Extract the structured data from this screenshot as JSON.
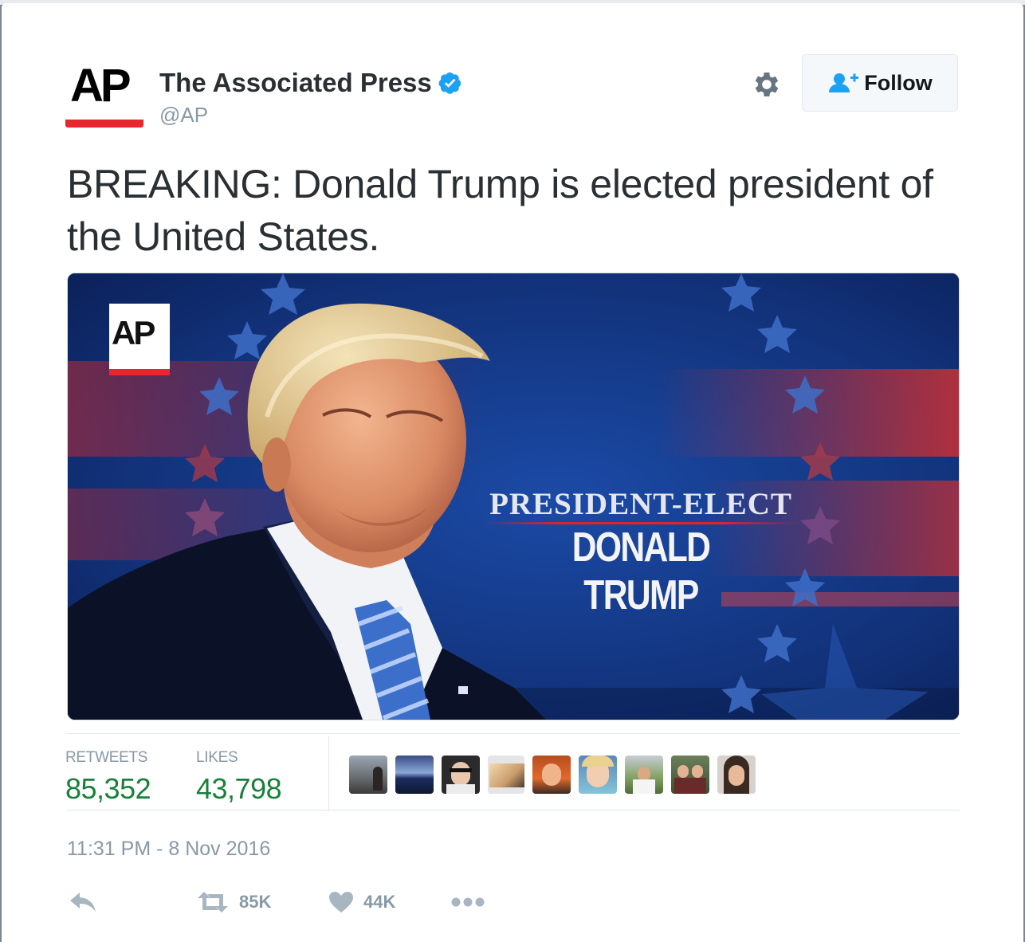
{
  "account": {
    "name": "The Associated Press",
    "handle": "@AP",
    "logo_text": "AP",
    "verified": true
  },
  "follow_button": {
    "label": "Follow"
  },
  "tweet": {
    "text": "BREAKING:  Donald Trump is elected president of the United States."
  },
  "media": {
    "logo_text": "AP",
    "line1": "PRESIDENT-ELECT",
    "line2": "DONALD TRUMP"
  },
  "stats": {
    "retweets_label": "RETWEETS",
    "retweets_value": "85,352",
    "likes_label": "LIKES",
    "likes_value": "43,798"
  },
  "liker_count_shown": 9,
  "timestamp": "11:31 PM - 8 Nov 2016",
  "actions": {
    "retweet_count": "85K",
    "like_count": "44K"
  },
  "colors": {
    "accent_blue": "#1da1f2",
    "stat_green": "#19803a",
    "ap_red": "#e8262d",
    "muted": "#8899a6"
  },
  "icons": [
    "verified-badge-icon",
    "gear-icon",
    "follow-person-icon",
    "reply-icon",
    "retweet-icon",
    "heart-icon",
    "more-icon"
  ]
}
